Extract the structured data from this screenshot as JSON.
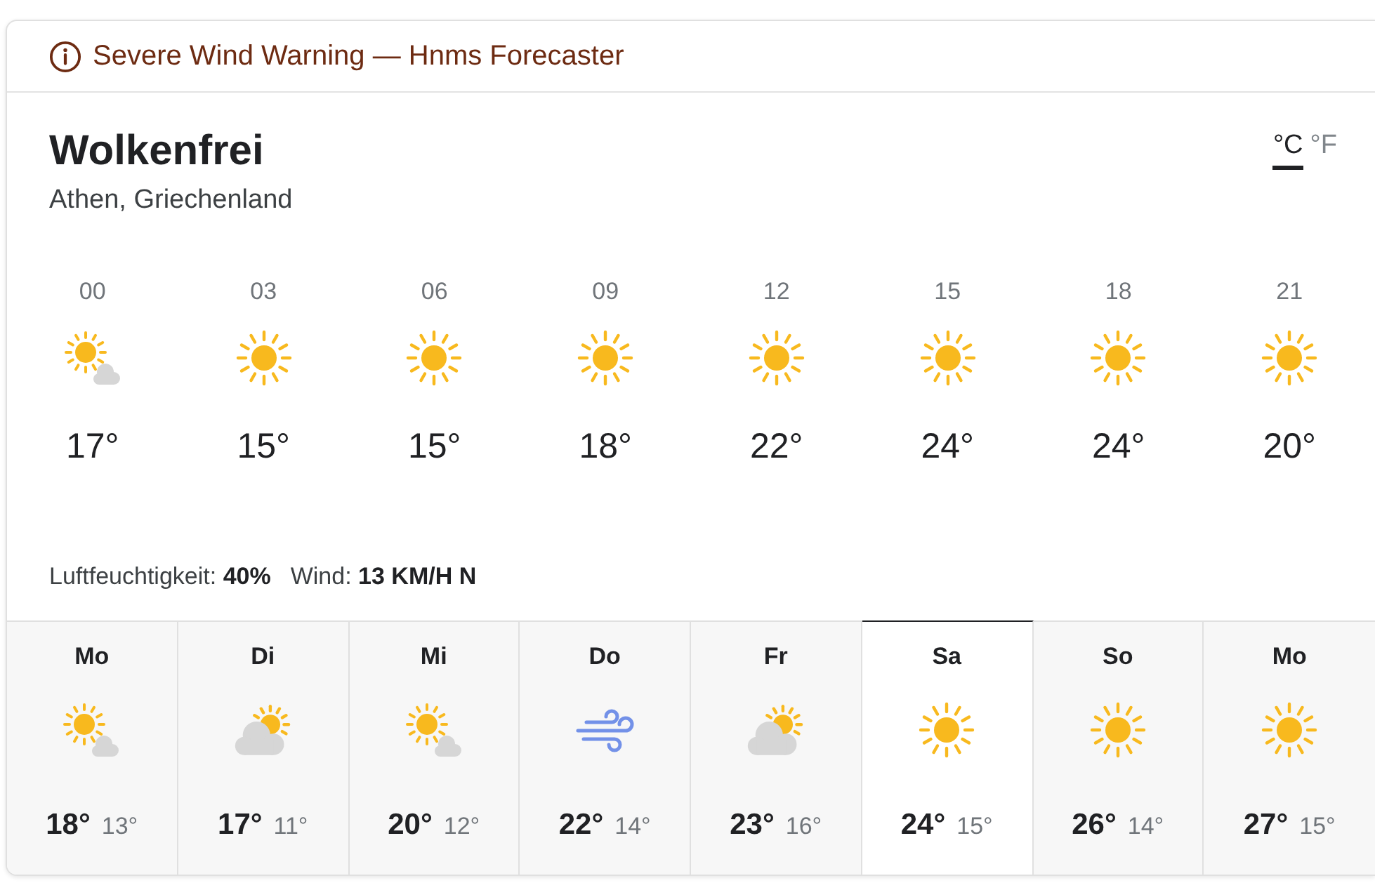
{
  "alert": {
    "text": "Severe Wind Warning — Hnms Forecaster"
  },
  "current": {
    "condition": "Wolkenfrei",
    "location": "Athen, Griechenland"
  },
  "units": [
    {
      "label": "°C",
      "selected": true
    },
    {
      "label": "°F",
      "selected": false
    }
  ],
  "hourly": [
    {
      "time": "00",
      "kind": "sun-cloud",
      "temp": "17°"
    },
    {
      "time": "03",
      "kind": "sun",
      "temp": "15°"
    },
    {
      "time": "06",
      "kind": "sun",
      "temp": "15°"
    },
    {
      "time": "09",
      "kind": "sun",
      "temp": "18°"
    },
    {
      "time": "12",
      "kind": "sun",
      "temp": "22°"
    },
    {
      "time": "15",
      "kind": "sun",
      "temp": "24°"
    },
    {
      "time": "18",
      "kind": "sun",
      "temp": "24°"
    },
    {
      "time": "21",
      "kind": "sun",
      "temp": "20°"
    }
  ],
  "details": [
    {
      "label": "Luftfeuchtigkeit:",
      "value": "40%"
    },
    {
      "label": "Wind:",
      "value": "13 KM/H N"
    }
  ],
  "daily": [
    {
      "day": "Mo",
      "kind": "sun-cloud",
      "high": "18°",
      "low": "13°",
      "selected": false
    },
    {
      "day": "Di",
      "kind": "cloud-sun",
      "high": "17°",
      "low": "11°",
      "selected": false
    },
    {
      "day": "Mi",
      "kind": "sun-cloud",
      "high": "20°",
      "low": "12°",
      "selected": false
    },
    {
      "day": "Do",
      "kind": "wind",
      "high": "22°",
      "low": "14°",
      "selected": false
    },
    {
      "day": "Fr",
      "kind": "cloud-sun",
      "high": "23°",
      "low": "16°",
      "selected": false
    },
    {
      "day": "Sa",
      "kind": "sun",
      "high": "24°",
      "low": "15°",
      "selected": true
    },
    {
      "day": "So",
      "kind": "sun",
      "high": "26°",
      "low": "14°",
      "selected": false
    },
    {
      "day": "Mo",
      "kind": "sun",
      "high": "27°",
      "low": "15°",
      "selected": false
    }
  ]
}
